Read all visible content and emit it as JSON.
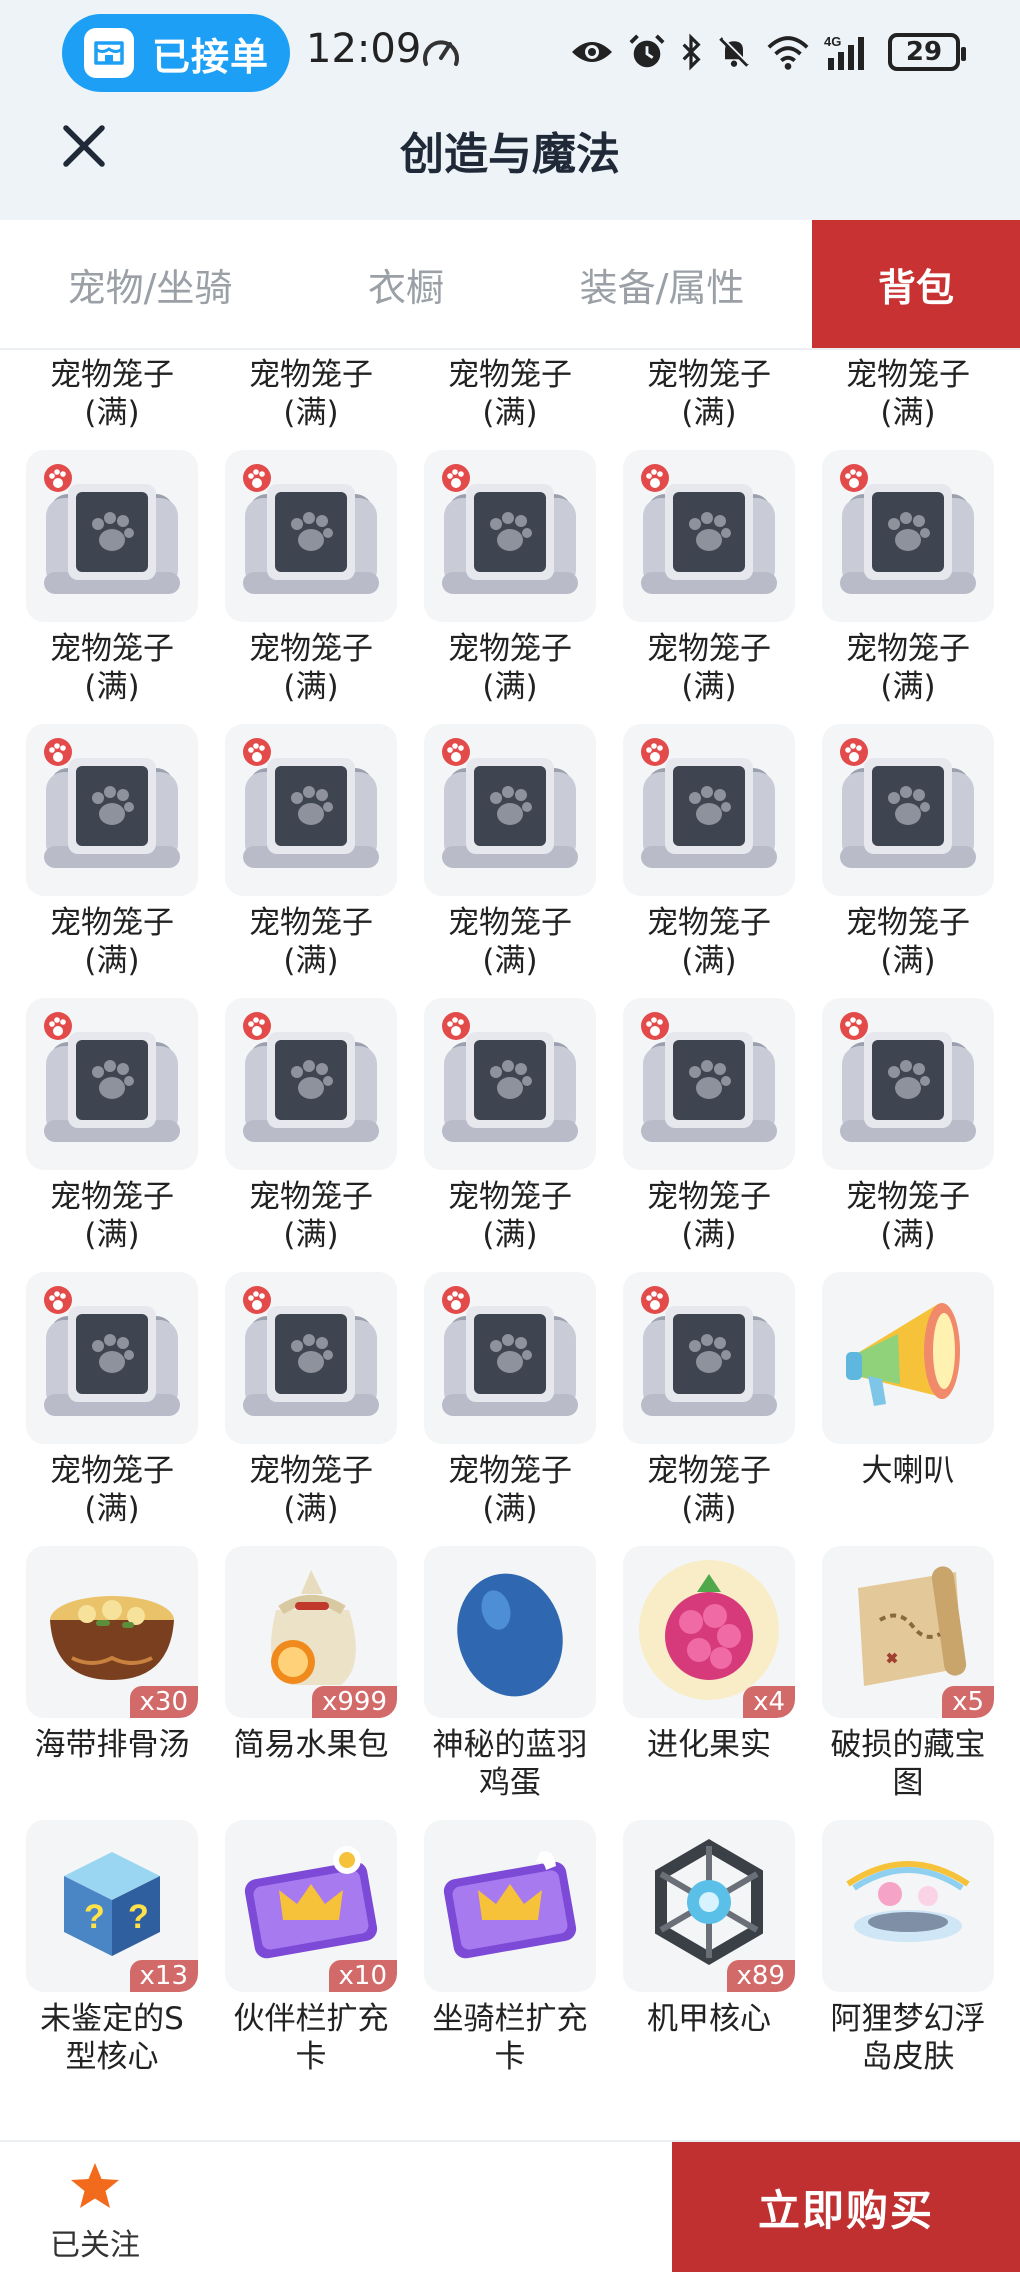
{
  "status_bar": {
    "order_status": "已接单",
    "time": "12:09",
    "battery": "29",
    "network": "4G"
  },
  "header": {
    "title": "创造与魔法"
  },
  "tabs": [
    {
      "label": "宠物/坐骑",
      "active": false
    },
    {
      "label": "衣橱",
      "active": false
    },
    {
      "label": "装备/属性",
      "active": false
    },
    {
      "label": "背包",
      "active": true
    }
  ],
  "items": [
    {
      "name": "宠物笼子\n(满)",
      "icon": "pet-cage-icon",
      "qty": ""
    },
    {
      "name": "宠物笼子\n(满)",
      "icon": "pet-cage-icon",
      "qty": ""
    },
    {
      "name": "宠物笼子\n(满)",
      "icon": "pet-cage-icon",
      "qty": ""
    },
    {
      "name": "宠物笼子\n(满)",
      "icon": "pet-cage-icon",
      "qty": ""
    },
    {
      "name": "宠物笼子\n(满)",
      "icon": "pet-cage-icon",
      "qty": ""
    },
    {
      "name": "宠物笼子\n(满)",
      "icon": "pet-cage-icon",
      "qty": ""
    },
    {
      "name": "宠物笼子\n(满)",
      "icon": "pet-cage-icon",
      "qty": ""
    },
    {
      "name": "宠物笼子\n(满)",
      "icon": "pet-cage-icon",
      "qty": ""
    },
    {
      "name": "宠物笼子\n(满)",
      "icon": "pet-cage-icon",
      "qty": ""
    },
    {
      "name": "宠物笼子\n(满)",
      "icon": "pet-cage-icon",
      "qty": ""
    },
    {
      "name": "宠物笼子\n(满)",
      "icon": "pet-cage-icon",
      "qty": ""
    },
    {
      "name": "宠物笼子\n(满)",
      "icon": "pet-cage-icon",
      "qty": ""
    },
    {
      "name": "宠物笼子\n(满)",
      "icon": "pet-cage-icon",
      "qty": ""
    },
    {
      "name": "宠物笼子\n(满)",
      "icon": "pet-cage-icon",
      "qty": ""
    },
    {
      "name": "宠物笼子\n(满)",
      "icon": "pet-cage-icon",
      "qty": ""
    },
    {
      "name": "宠物笼子\n(满)",
      "icon": "pet-cage-icon",
      "qty": ""
    },
    {
      "name": "宠物笼子\n(满)",
      "icon": "pet-cage-icon",
      "qty": ""
    },
    {
      "name": "宠物笼子\n(满)",
      "icon": "pet-cage-icon",
      "qty": ""
    },
    {
      "name": "宠物笼子\n(满)",
      "icon": "pet-cage-icon",
      "qty": ""
    },
    {
      "name": "宠物笼子\n(满)",
      "icon": "pet-cage-icon",
      "qty": ""
    },
    {
      "name": "宠物笼子\n(满)",
      "icon": "pet-cage-icon",
      "qty": ""
    },
    {
      "name": "宠物笼子\n(满)",
      "icon": "pet-cage-icon",
      "qty": ""
    },
    {
      "name": "宠物笼子\n(满)",
      "icon": "pet-cage-icon",
      "qty": ""
    },
    {
      "name": "宠物笼子\n(满)",
      "icon": "pet-cage-icon",
      "qty": ""
    },
    {
      "name": "大喇叭",
      "icon": "megaphone-icon",
      "qty": ""
    },
    {
      "name": "海带排骨汤",
      "icon": "soup-bowl-icon",
      "qty": "x30"
    },
    {
      "name": "简易水果包",
      "icon": "fruit-bag-icon",
      "qty": "x999"
    },
    {
      "name": "神秘的蓝羽\n鸡蛋",
      "icon": "blue-egg-icon",
      "qty": ""
    },
    {
      "name": "进化果实",
      "icon": "evolution-fruit-icon",
      "qty": "x4"
    },
    {
      "name": "破损的藏宝\n图",
      "icon": "treasure-map-icon",
      "qty": "x5"
    },
    {
      "name": "未鉴定的S\n型核心",
      "icon": "mystery-cube-icon",
      "qty": "x13"
    },
    {
      "name": "伙伴栏扩充\n卡",
      "icon": "partner-card-icon",
      "qty": "x10"
    },
    {
      "name": "坐骑栏扩充\n卡",
      "icon": "mount-card-icon",
      "qty": ""
    },
    {
      "name": "机甲核心",
      "icon": "mech-core-icon",
      "qty": "x89"
    },
    {
      "name": "阿狸梦幻浮\n岛皮肤",
      "icon": "island-skin-icon",
      "qty": ""
    }
  ],
  "bottom": {
    "follow_label": "已关注",
    "buy_label": "立即购买"
  }
}
